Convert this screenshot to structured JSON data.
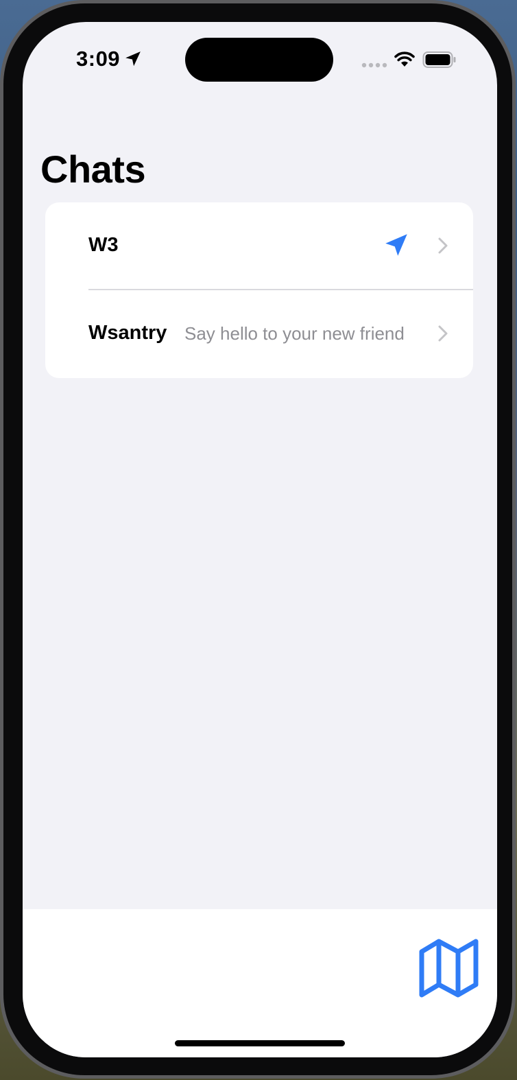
{
  "status_bar": {
    "time": "3:09",
    "icons": [
      "location-arrow-icon",
      "cellular-signal-icon",
      "wifi-icon",
      "battery-icon"
    ]
  },
  "page": {
    "title": "Chats"
  },
  "chats": [
    {
      "name": "W3",
      "preview": "",
      "icon": "send-icon"
    },
    {
      "name": "Wsantry",
      "preview": "Say hello to your new friend",
      "icon": ""
    }
  ],
  "bottom_bar": {
    "map_icon": "map-icon"
  },
  "colors": {
    "background": "#f2f2f7",
    "card": "#ffffff",
    "accent": "#2f7cf6",
    "secondary_text": "#8e8e93",
    "chevron": "#c4c4c7"
  }
}
